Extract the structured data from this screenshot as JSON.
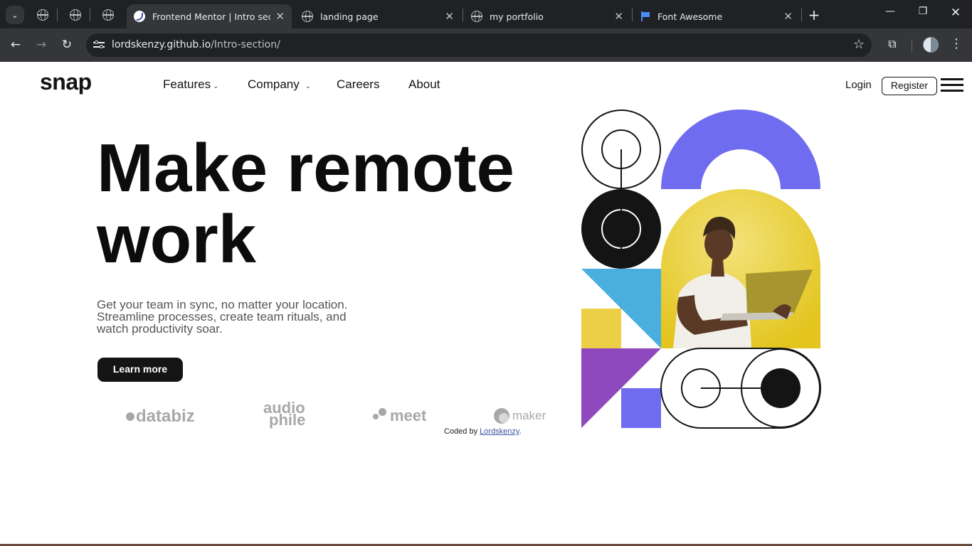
{
  "browser": {
    "tabs": [
      {
        "title": "Frontend Mentor | Intro section",
        "active": true
      },
      {
        "title": "landing page",
        "active": false
      },
      {
        "title": "my portfolio",
        "active": false
      },
      {
        "title": "Font Awesome",
        "active": false
      }
    ],
    "url_host": "lordskenzy.github.io",
    "url_path": "/Intro-section/"
  },
  "site": {
    "logo": "snap",
    "nav": [
      "Features",
      "Company",
      "Careers",
      "About"
    ],
    "login": "Login",
    "register": "Register"
  },
  "hero": {
    "headline_line1": "Make remote",
    "headline_line2": "work",
    "sub_line1": "Get your team in sync, no matter your location.",
    "sub_line2": "Streamline processes, create team rituals, and",
    "sub_line3": "watch productivity soar.",
    "cta": "Learn more"
  },
  "clients": {
    "databiz": "databiz",
    "audiophile_1": "audio",
    "audiophile_2": "phile",
    "meet": "meet",
    "maker": "maker"
  },
  "footer": {
    "credit_prefix": "Coded by ",
    "credit_name": "Lordskenzy",
    "credit_suffix": "."
  },
  "colors": {
    "accent_purple": "#6f6cf0",
    "accent_yellow": "#edcf45",
    "accent_blue": "#4aaedf",
    "accent_violet": "#8e49bf",
    "text_dark": "#141414"
  }
}
